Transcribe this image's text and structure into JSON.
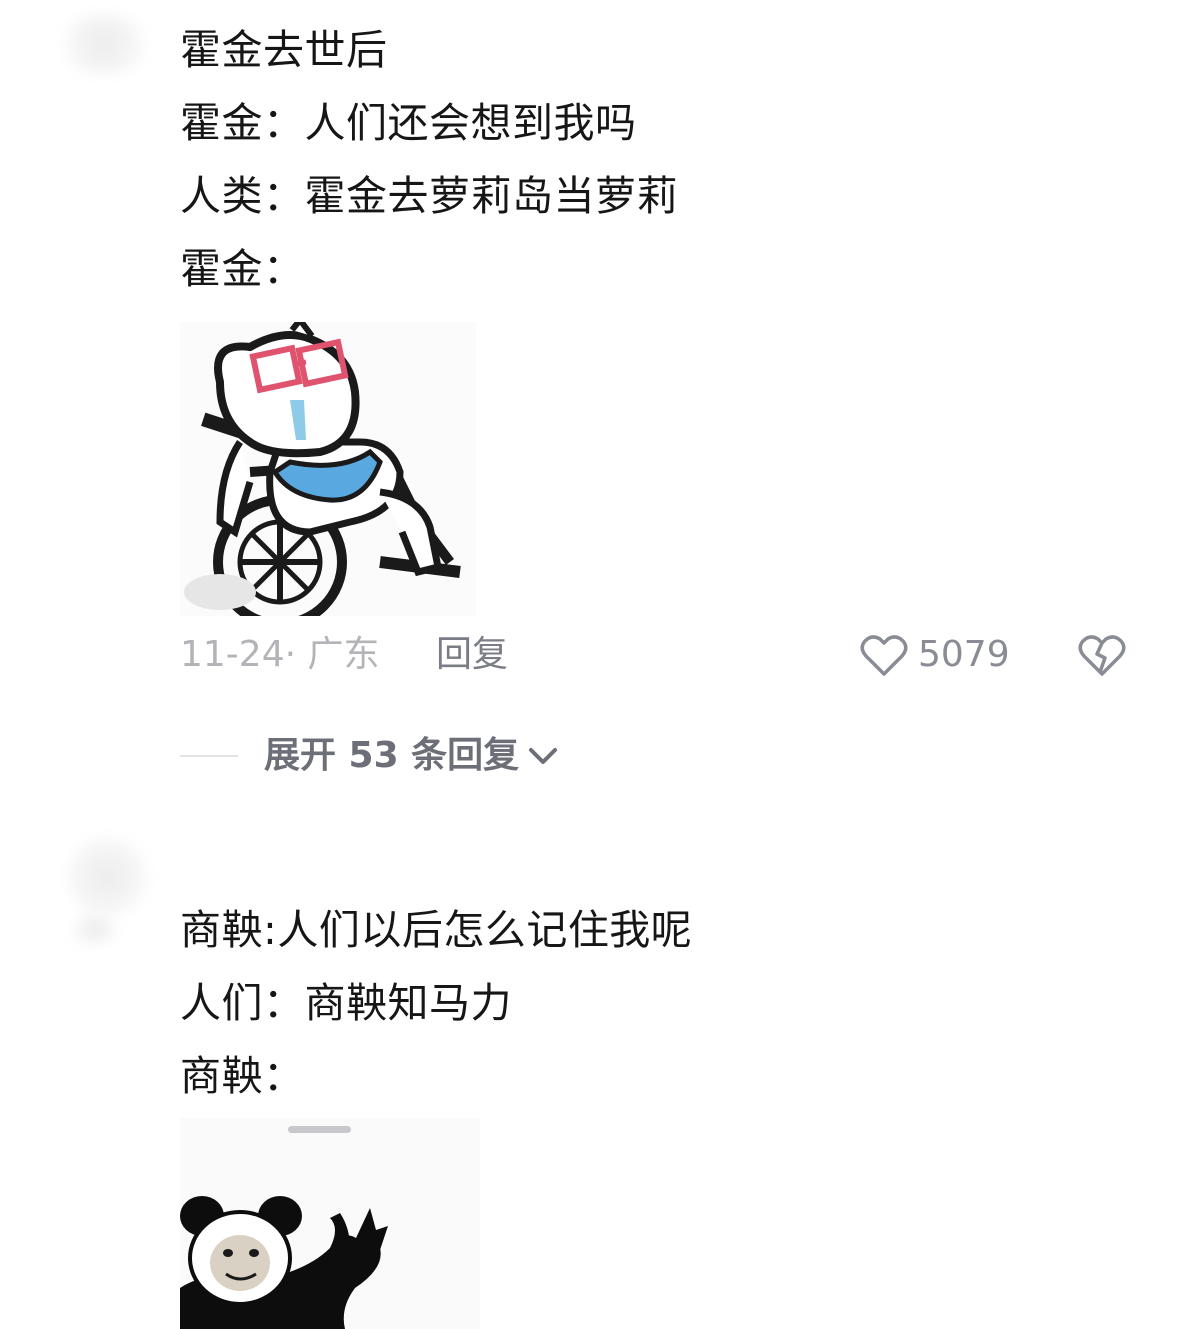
{
  "comment1": {
    "lines": [
      "霍金去世后",
      "霍金：人们还会想到我吗",
      "人类：霍金去萝莉岛当萝莉",
      "霍金："
    ],
    "sticker": "wheelchair-cat-with-glasses-sticker",
    "date_location": "11-24· 广东",
    "reply_label": "回复",
    "like_count": "5079",
    "expand_label": "展开 53 条回复"
  },
  "comment2": {
    "lines": [
      "商鞅:人们以后怎么记住我呢",
      "人们：商鞅知马力",
      "商鞅："
    ],
    "sticker": "panda-head-meme-sticker"
  },
  "icons": {
    "like": "heart-outline-icon",
    "dislike": "broken-heart-icon",
    "expand": "chevron-down-icon"
  },
  "colors": {
    "text": "#161616",
    "meta": "#b3b3b8",
    "action": "#7b7d86",
    "sticker_glasses": "#e0536e",
    "sticker_shirt": "#5aa8e0"
  }
}
